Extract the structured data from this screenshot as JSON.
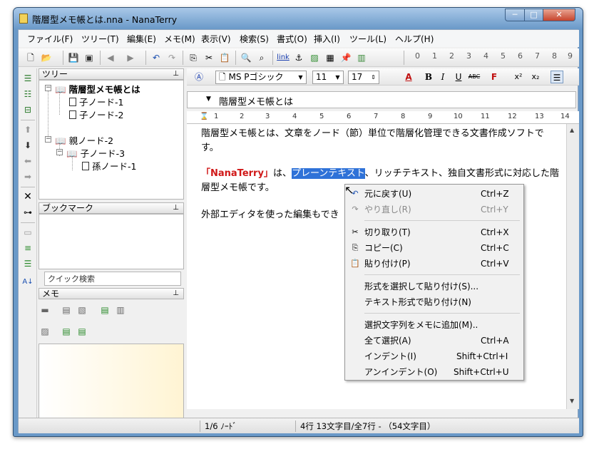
{
  "window": {
    "title": "階層型メモ帳とは.nna - NanaTerry",
    "min": "─",
    "max": "□",
    "close": "✕"
  },
  "menubar": [
    "ファイル(F)",
    "ツリー(T)",
    "編集(E)",
    "メモ(M)",
    "表示(V)",
    "検索(S)",
    "書式(O)",
    "挿入(I)",
    "ツール(L)",
    "ヘルプ(H)"
  ],
  "toolbar": {
    "icons": [
      "new-icon",
      "open-icon",
      "save-icon",
      "saveall-icon",
      "back-icon",
      "forward-icon",
      "undo-icon",
      "redo-icon",
      "copy-icon",
      "cut-icon",
      "paste-icon",
      "find-icon",
      "findnext-icon",
      "link-icon",
      "anchor-icon",
      "image-icon",
      "table-icon",
      "pin-icon",
      "chart-icon"
    ],
    "link_label": "link",
    "numbers": [
      "0",
      "1",
      "2",
      "3",
      "4",
      "5",
      "6",
      "7",
      "8",
      "9"
    ]
  },
  "tree_pane": {
    "title": "ツリー",
    "pin": "⊥",
    "nodes": [
      {
        "label": "階層型メモ帳とは",
        "type": "book",
        "bold": true
      },
      {
        "label": "子ノード-1",
        "type": "page"
      },
      {
        "label": "子ノード-2",
        "type": "page"
      },
      {
        "label": "親ノード-2",
        "type": "book"
      },
      {
        "label": "子ノード-3",
        "type": "book"
      },
      {
        "label": "孫ノード-1",
        "type": "page"
      }
    ]
  },
  "bookmark_pane": {
    "title": "ブックマーク",
    "pin": "⊥"
  },
  "quick_search": {
    "value": "クイック検索"
  },
  "memo_pane": {
    "title": "メモ",
    "pin": "⊥"
  },
  "format_bar": {
    "font": "MS Pゴシック",
    "size": "11",
    "line": "17",
    "bold": "B",
    "italic": "I",
    "underline": "U",
    "strike": "ABC",
    "sup": "x²",
    "sub": "x₂"
  },
  "node_title": "階層型メモ帳とは",
  "ruler": [
    "1",
    "2",
    "3",
    "4",
    "5",
    "6",
    "7",
    "8",
    "9",
    "10",
    "11",
    "12",
    "13",
    "14"
  ],
  "editor": {
    "line1": "階層型メモ帳とは、文章をノード（節）単位で階層化管理できる文書作成ソフトで",
    "line2": "す。",
    "line3_red": "「NanaTerry」",
    "line3_a": "は、",
    "line3_sel": "プレーンテキスト",
    "line3_b": "、リッチテキスト、独自文書形式に対応した階",
    "line4": "層型メモ帳です。",
    "line5": "外部エディタを使った編集もでき"
  },
  "context_menu": [
    {
      "label": "元に戻す(U)",
      "shortcut": "Ctrl+Z",
      "icon": "undo-icon",
      "enabled": true
    },
    {
      "label": "やり直し(R)",
      "shortcut": "Ctrl+Y",
      "icon": "redo-icon",
      "enabled": false
    },
    {
      "sep": true
    },
    {
      "label": "切り取り(T)",
      "shortcut": "Ctrl+X",
      "icon": "cut-icon",
      "enabled": true
    },
    {
      "label": "コピー(C)",
      "shortcut": "Ctrl+C",
      "icon": "copy-icon",
      "enabled": true
    },
    {
      "label": "貼り付け(P)",
      "shortcut": "Ctrl+V",
      "icon": "paste-icon",
      "enabled": true
    },
    {
      "sep": true
    },
    {
      "label": "形式を選択して貼り付け(S)...",
      "shortcut": "",
      "enabled": true
    },
    {
      "label": "テキスト形式で貼り付け(N)",
      "shortcut": "",
      "enabled": true
    },
    {
      "sep": true
    },
    {
      "label": "選択文字列をメモに追加(M)..",
      "shortcut": "",
      "enabled": true
    },
    {
      "label": "全て選択(A)",
      "shortcut": "Ctrl+A",
      "enabled": true
    },
    {
      "label": "インデント(I)",
      "shortcut": "Shift+Ctrl+I",
      "enabled": true
    },
    {
      "label": "アンインデント(O)",
      "shortcut": "Shift+Ctrl+U",
      "enabled": true
    }
  ],
  "status": {
    "nodes": "1/6 ﾉｰﾄﾞ",
    "position": "4行 13文字目/全7行 - （54文字目）"
  },
  "colors": {
    "selection": "#2f72d8",
    "accent_red": "#d01818",
    "titlebar": "#6a99c8"
  }
}
